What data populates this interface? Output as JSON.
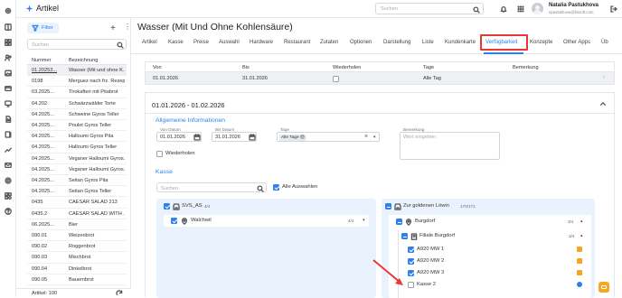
{
  "app": {
    "title": "Artikel",
    "logo": "sparkle-logo"
  },
  "topbar": {
    "search_placeholder": "Suchen",
    "user_name": "Natalia Pastukhova",
    "user_email": "npastukhova@hssoft.com"
  },
  "sidebar_list": {
    "filter_label": "Filter",
    "search_placeholder": "Suchen",
    "col_number": "Nummer",
    "col_name": "Bezeichnung",
    "footer": "Artikel: 100",
    "rows": [
      {
        "num": "01.20253...",
        "name": "Wasser (Mit und ohne K..."
      },
      {
        "num": "0198",
        "name": "Merguez nach frz. Rezep..."
      },
      {
        "num": "03.2025...",
        "name": "Tirokafteri mit Pitabrot"
      },
      {
        "num": "04.202",
        "name": "Schwärzwälder Torte"
      },
      {
        "num": "04.2025...",
        "name": "Schweine Gyros Teller"
      },
      {
        "num": "04.2025...",
        "name": "Poulet Gyros Teller"
      },
      {
        "num": "04.2025...",
        "name": "Halloumi Gyros Pita"
      },
      {
        "num": "04.2025...",
        "name": "Halloumi Gyros Teller"
      },
      {
        "num": "04.2025...",
        "name": "Veganer Halloumi Gyros..."
      },
      {
        "num": "04.2025...",
        "name": "Veganer Halloumi Gyros..."
      },
      {
        "num": "04.2025...",
        "name": "Seitan Gyros Pita"
      },
      {
        "num": "04.2025...",
        "name": "Seitan Gyros Teller"
      },
      {
        "num": "0435",
        "name": "CAESAR SALAD 213"
      },
      {
        "num": "0435.2",
        "name": "CAESAR SALAD WITH ..."
      },
      {
        "num": "06.2025...",
        "name": "Bier"
      },
      {
        "num": "090.01",
        "name": "Weizenbrot"
      },
      {
        "num": "090.02",
        "name": "Roggenbrot"
      },
      {
        "num": "090.03",
        "name": "Mischbrot"
      },
      {
        "num": "090.04",
        "name": "Dinkelbrot"
      },
      {
        "num": "090.05",
        "name": "Bauernbrot"
      }
    ]
  },
  "page": {
    "title": "Wasser (Mit Und Ohne Kohlensäure)",
    "tabs": [
      "Artikel",
      "Kasse",
      "Preise",
      "Auswahl",
      "Hardware",
      "Restaurant",
      "Zutaten",
      "Optionen",
      "Darstellung",
      "Liste",
      "Kundenkarte",
      "Verfügbarkeit",
      "Konzepte",
      "Other Apps",
      "Üb"
    ],
    "active_tab": "Verfügbarkeit"
  },
  "table": {
    "headers": [
      "Von",
      "Bis",
      "Wiederholen",
      "Tage",
      "Bemerkung"
    ],
    "row": {
      "von": "01.01.2026",
      "bis": "31.01.2026",
      "tage": "Alle Tag"
    }
  },
  "section": {
    "title": "01.01.2026 - 01.02.2026",
    "general_heading": "Allgemeine Informationen",
    "von_label": "Von Datum",
    "von_value": "01.01.2026",
    "bis_label": "Bis Datum",
    "bis_value": "31.01.2026",
    "tage_label": "Tage",
    "tage_chip": "Alle Tage",
    "bemerkung_label": "Bemerkung",
    "bemerkung_placeholder": "Wert eingeben",
    "wiederholen_label": "Wiederholen",
    "kasse_heading": "Kasse",
    "kasse_search_placeholder": "Suchen",
    "alle_auswahlen": "Alle Auswahlen"
  },
  "left_tree": {
    "group": "SVS_AS",
    "group_count": "4/4",
    "item": "Walchwil",
    "item_count": "4/4"
  },
  "right_tree": {
    "group": "Zur goldenen Löwin",
    "group_count": "170/171",
    "sub": "Burgdorf",
    "sub_count": "3/4",
    "filiale": "Filiale Burgdorf",
    "filiale_count": "3/4",
    "items": [
      "A920 MW 1",
      "A920 MW 2",
      "A920 MW 3",
      "Kasse 2"
    ]
  },
  "colors": {
    "accent": "#2f80ed",
    "highlight": "#e53935",
    "orange": "#f5a623"
  }
}
